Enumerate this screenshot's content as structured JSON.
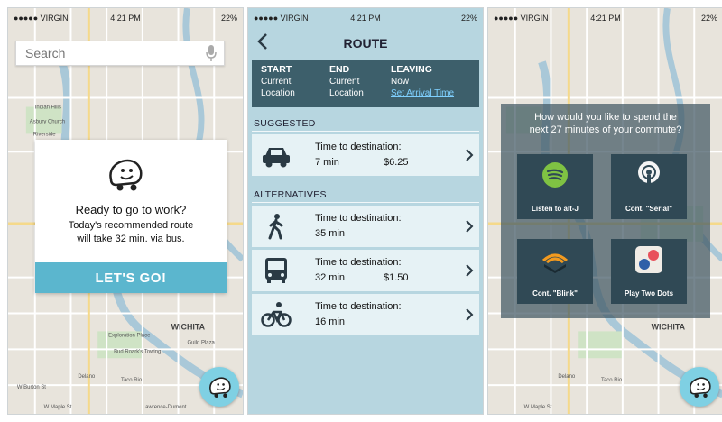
{
  "status": {
    "carrier": "●●●●● VIRGIN",
    "time": "4:21 PM",
    "battery": "22%"
  },
  "screen1": {
    "search_placeholder": "Search",
    "card": {
      "title": "Ready to go to work?",
      "line1": "Today's recommended route",
      "line2": "will take 32 min. via bus.",
      "button": "LET'S GO!"
    },
    "map_labels": [
      "WICHITA",
      "Exploration Place",
      "Bud Roark's Towing",
      "Taco Rio",
      "W Burton St",
      "W Maple St",
      "Lawrence-Dumont",
      "Delano",
      "Guild Plaza",
      "Indian Hills",
      "Riverside",
      "Asbury Church"
    ],
    "map_colors": {
      "land": "#e8e4dc",
      "park": "#cfe3c5",
      "water": "#a9c8d8",
      "road": "#ffffff"
    }
  },
  "screen2": {
    "title": "ROUTE",
    "header": {
      "start_label": "START",
      "start_l1": "Current",
      "start_l2": "Location",
      "end_label": "END",
      "end_l1": "Current",
      "end_l2": "Location",
      "leaving_label": "LEAVING",
      "leaving_value": "Now",
      "leaving_link": "Set Arrival Time"
    },
    "suggested_label": "SUGGESTED",
    "alternatives_label": "ALTERNATIVES",
    "routes": [
      {
        "mode": "car-icon",
        "label": "Time to destination:",
        "time": "7 min",
        "cost": "$6.25"
      },
      {
        "mode": "walk-icon",
        "label": "Time to destination:",
        "time": "35 min",
        "cost": ""
      },
      {
        "mode": "bus-icon",
        "label": "Time to destination:",
        "time": "32 min",
        "cost": "$1.50"
      },
      {
        "mode": "bike-icon",
        "label": "Time to destination:",
        "time": "16 min",
        "cost": ""
      }
    ],
    "colors": {
      "bg": "#b7d6e0",
      "header": "#3d5f6b",
      "row": "#e6f2f5"
    }
  },
  "screen3": {
    "question": "How would you like to spend the next 27 minutes of your commute?",
    "question_l1": "How would you like to spend the",
    "question_l2": "next 27 minutes of your commute?",
    "options": [
      {
        "icon": "spotify-icon",
        "label": "Listen to alt-J"
      },
      {
        "icon": "podcast-icon",
        "label": "Cont. \"Serial\""
      },
      {
        "icon": "audible-icon",
        "label": "Cont. \"Blink\""
      },
      {
        "icon": "two-dots-icon",
        "label": "Play Two Dots"
      }
    ],
    "colors": {
      "spotify": "#7fc243",
      "two_dots_red": "#e8505b",
      "two_dots_blue": "#2f5fa8",
      "audible": "#f39a1e"
    }
  },
  "accent": "#5bb6ce"
}
